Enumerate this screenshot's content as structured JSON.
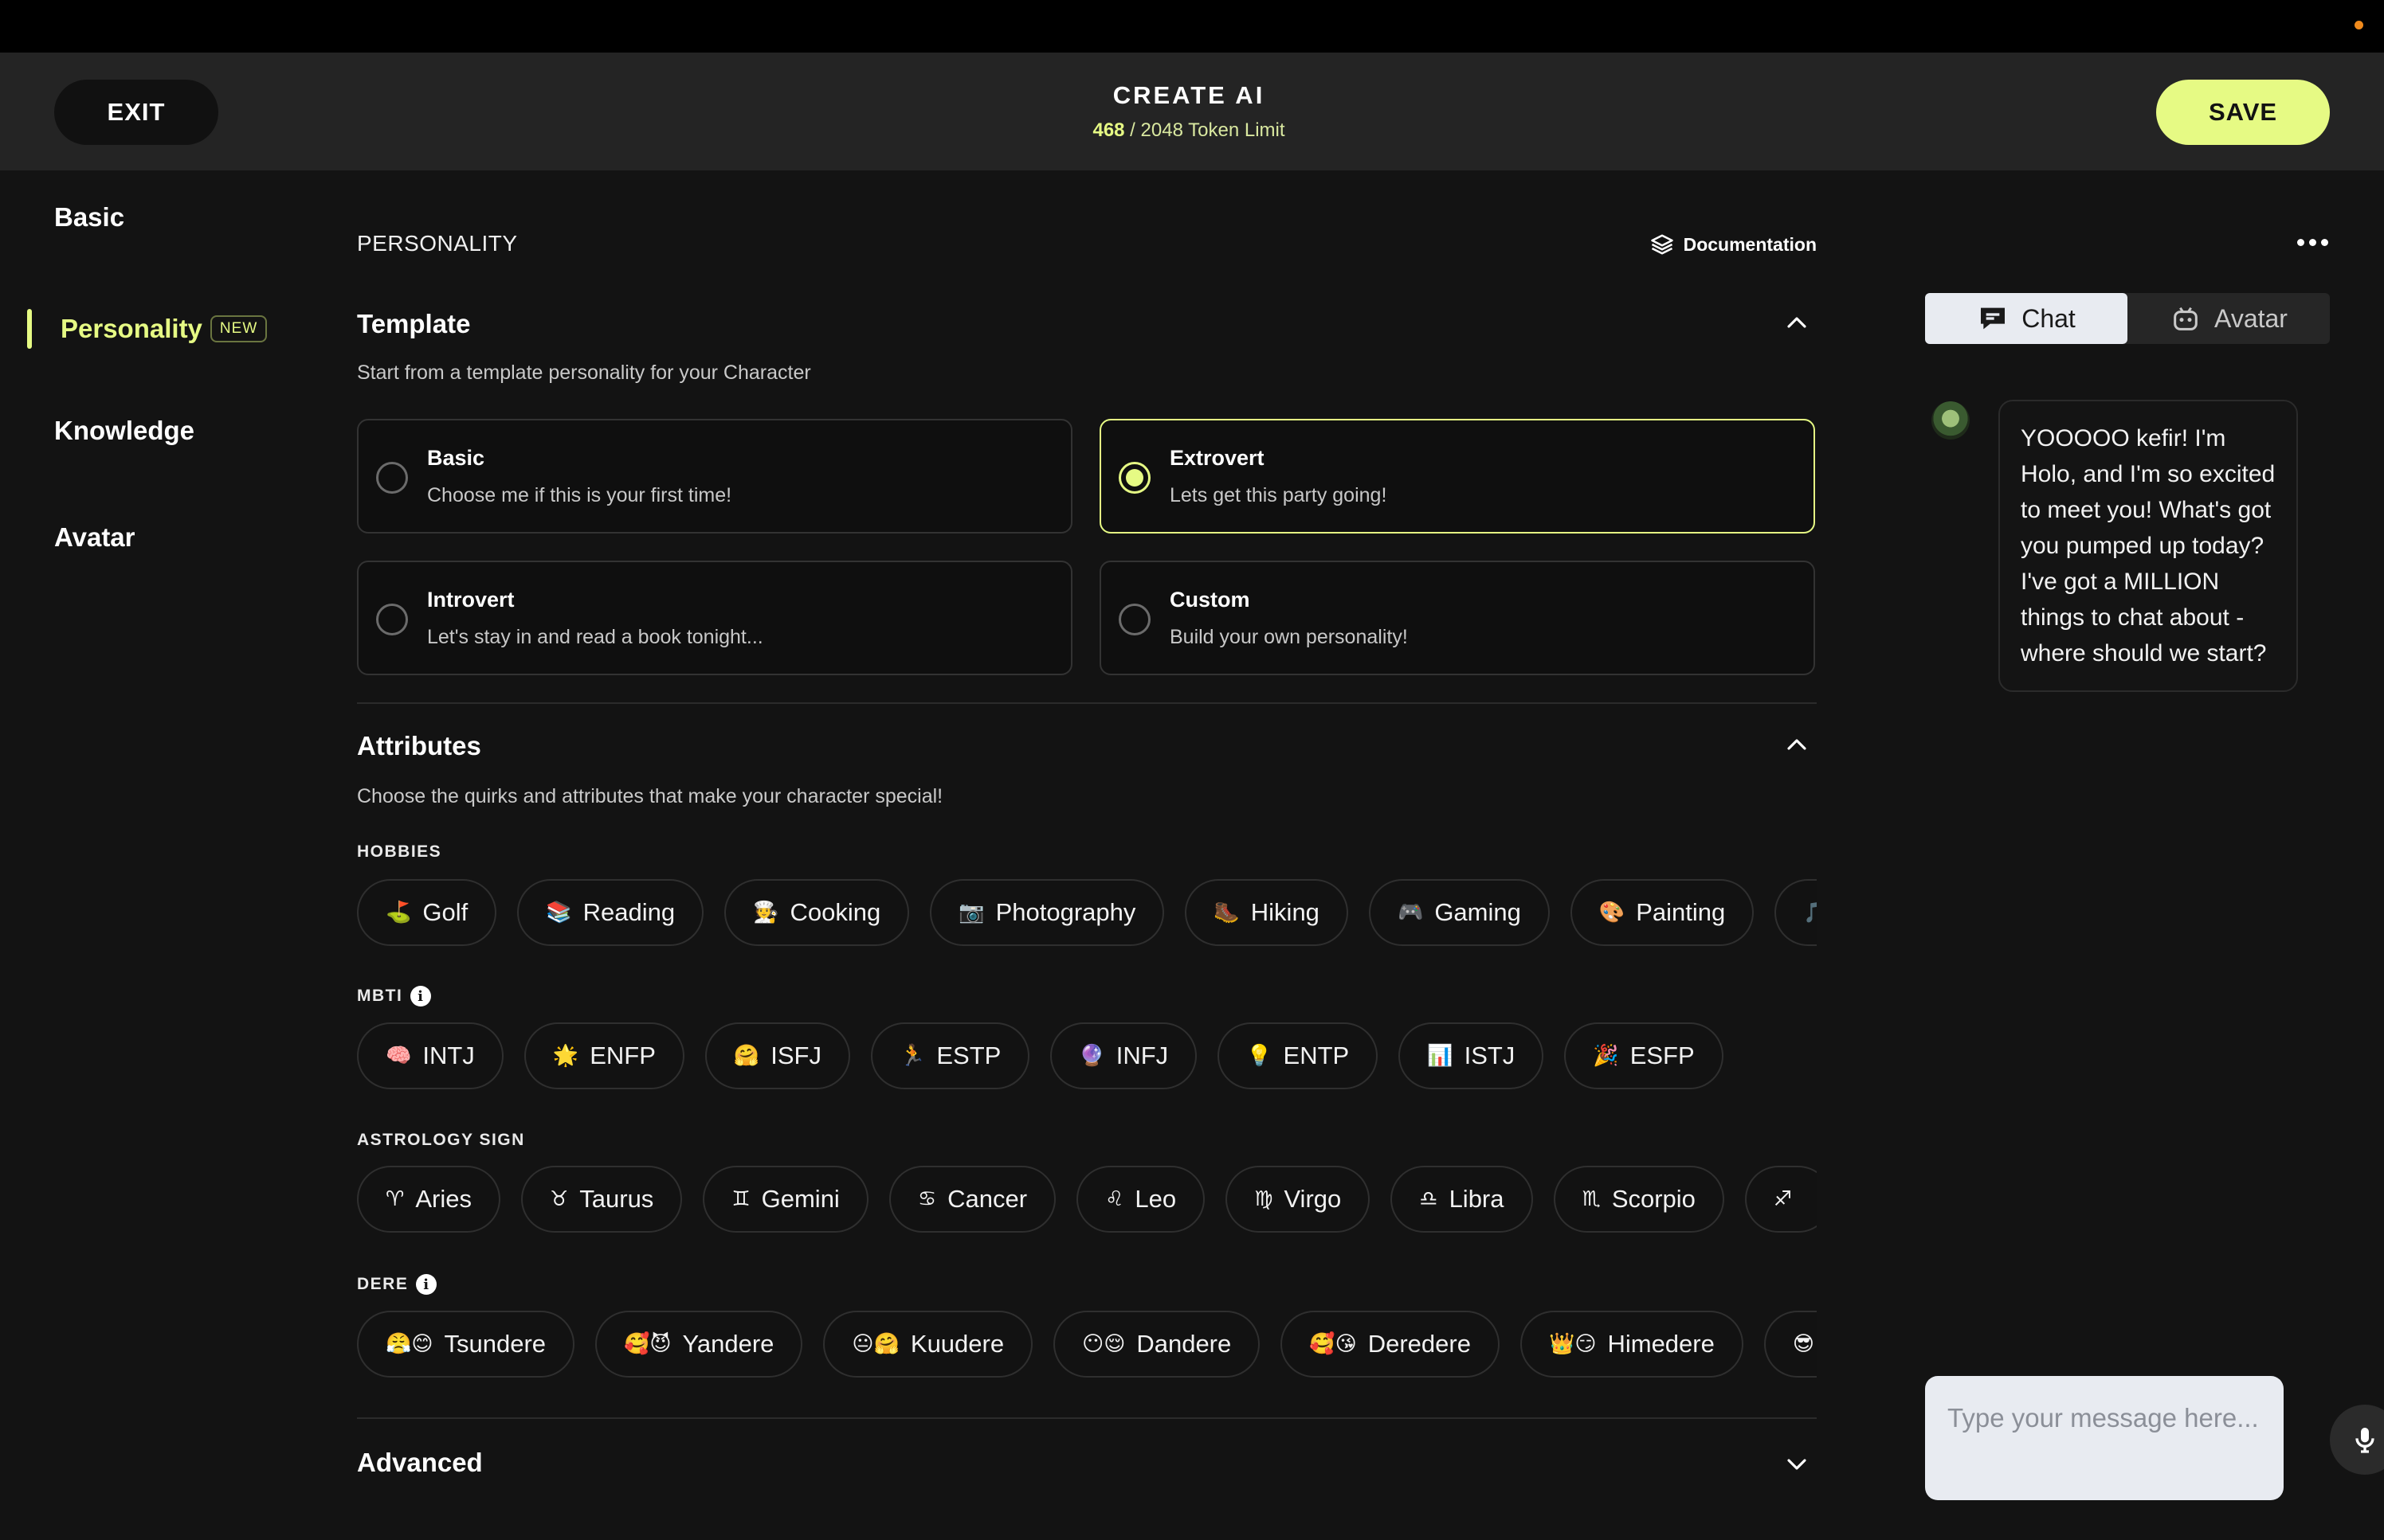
{
  "header": {
    "exit_label": "EXIT",
    "save_label": "SAVE",
    "title": "CREATE AI",
    "token_used": "468",
    "token_limit_text": " / 2048 Token Limit"
  },
  "sidebar": {
    "items": [
      {
        "label": "Basic"
      },
      {
        "label": "Personality",
        "badge": "NEW"
      },
      {
        "label": "Knowledge"
      },
      {
        "label": "Avatar"
      }
    ]
  },
  "main": {
    "section_label": "PERSONALITY",
    "documentation_label": "Documentation",
    "template": {
      "title": "Template",
      "subtitle": "Start from a template personality for your Character",
      "options": [
        {
          "title": "Basic",
          "desc": "Choose me if this is your first time!",
          "selected": false
        },
        {
          "title": "Extrovert",
          "desc": "Lets get this party going!",
          "selected": true
        },
        {
          "title": "Introvert",
          "desc": "Let's stay in and read a book tonight...",
          "selected": false
        },
        {
          "title": "Custom",
          "desc": "Build your own personality!",
          "selected": false
        }
      ]
    },
    "attributes": {
      "title": "Attributes",
      "subtitle": "Choose the quirks and attributes that make your character special!",
      "hobbies_label": "HOBBIES",
      "mbti_label": "MBTI",
      "astrology_label": "ASTROLOGY SIGN",
      "dere_label": "DERE",
      "hobbies": [
        {
          "emoji": "⛳",
          "label": "Golf"
        },
        {
          "emoji": "📚",
          "label": "Reading"
        },
        {
          "emoji": "🧑‍🍳",
          "label": "Cooking"
        },
        {
          "emoji": "📷",
          "label": "Photography"
        },
        {
          "emoji": "🥾",
          "label": "Hiking"
        },
        {
          "emoji": "🎮",
          "label": "Gaming"
        },
        {
          "emoji": "🎨",
          "label": "Painting"
        },
        {
          "emoji": "🎵",
          "label": ""
        }
      ],
      "mbti": [
        {
          "emoji": "🧠",
          "label": "INTJ"
        },
        {
          "emoji": "🌟",
          "label": "ENFP"
        },
        {
          "emoji": "🤗",
          "label": "ISFJ"
        },
        {
          "emoji": "🏃",
          "label": "ESTP"
        },
        {
          "emoji": "🔮",
          "label": "INFJ"
        },
        {
          "emoji": "💡",
          "label": "ENTP"
        },
        {
          "emoji": "📊",
          "label": "ISTJ"
        },
        {
          "emoji": "🎉",
          "label": "ESFP"
        }
      ],
      "astrology": [
        {
          "emoji": "♈",
          "label": "Aries"
        },
        {
          "emoji": "♉",
          "label": "Taurus"
        },
        {
          "emoji": "♊",
          "label": "Gemini"
        },
        {
          "emoji": "♋",
          "label": "Cancer"
        },
        {
          "emoji": "♌",
          "label": "Leo"
        },
        {
          "emoji": "♍",
          "label": "Virgo"
        },
        {
          "emoji": "♎",
          "label": "Libra"
        },
        {
          "emoji": "♏",
          "label": "Scorpio"
        },
        {
          "emoji": "♐",
          "label": ""
        }
      ],
      "dere": [
        {
          "emoji": "😤😊",
          "label": "Tsundere"
        },
        {
          "emoji": "🥰😈",
          "label": "Yandere"
        },
        {
          "emoji": "😐🤗",
          "label": "Kuudere"
        },
        {
          "emoji": "😶😌",
          "label": "Dandere"
        },
        {
          "emoji": "🥰😘",
          "label": "Deredere"
        },
        {
          "emoji": "👑😏",
          "label": "Himedere"
        },
        {
          "emoji": "😎",
          "label": ""
        }
      ]
    },
    "advanced": {
      "title": "Advanced"
    }
  },
  "chat": {
    "tab_chat": "Chat",
    "tab_avatar": "Avatar",
    "message": "YOOOOO kefir! I'm Holo, and I'm so excited to meet you! What's got you pumped up today? I've got a MILLION things to chat about - where should we start?",
    "input_placeholder": "Type your message here..."
  },
  "colors": {
    "accent": "#e6fa84",
    "background": "#131313",
    "header": "#242424"
  }
}
